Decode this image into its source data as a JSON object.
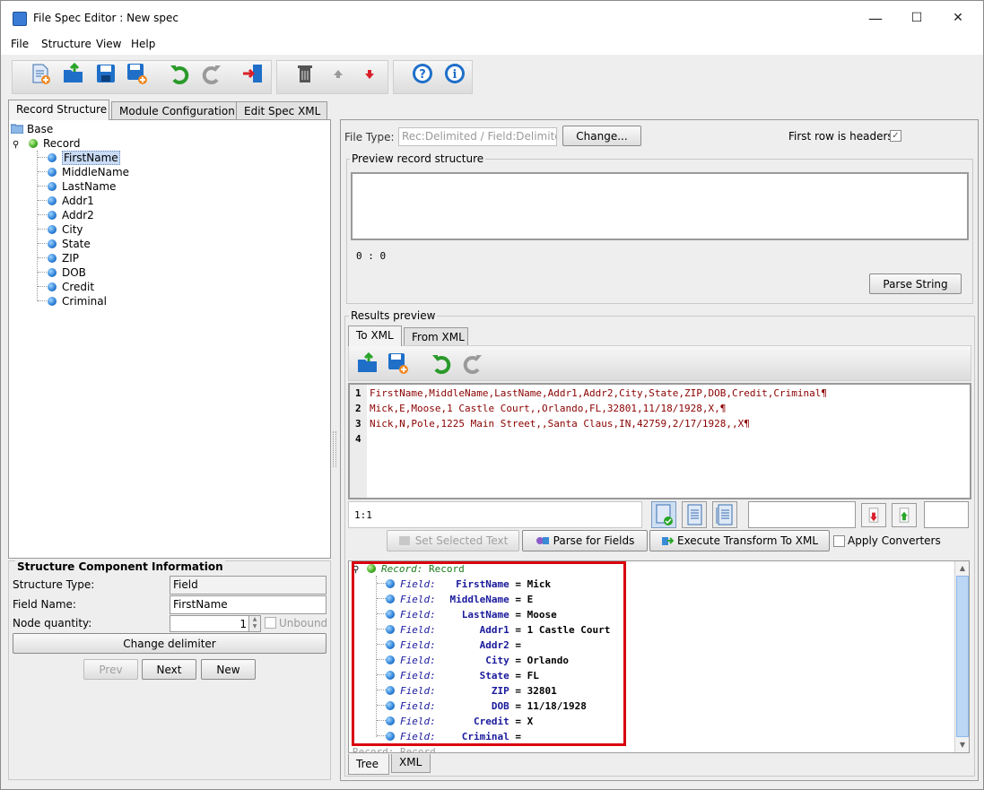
{
  "window": {
    "title": "File Spec Editor : New spec",
    "minimize": "—",
    "maximize": "☐",
    "close": "✕"
  },
  "menu": [
    "File",
    "Structure",
    "View",
    "Help"
  ],
  "left_tabs": [
    "Record Structure",
    "Module Configuration",
    "Edit Spec XML"
  ],
  "tree": {
    "root": "Base",
    "record": "Record",
    "fields": [
      "FirstName",
      "MiddleName",
      "LastName",
      "Addr1",
      "Addr2",
      "City",
      "State",
      "ZIP",
      "DOB",
      "Credit",
      "Criminal"
    ],
    "selected": "FirstName"
  },
  "sci": {
    "title": "Structure Component Information",
    "structure_type_label": "Structure Type:",
    "structure_type": "Field",
    "field_name_label": "Field Name:",
    "field_name": "FirstName",
    "node_quantity_label": "Node quantity:",
    "node_quantity": "1",
    "unbound_label": "Unbound",
    "change_delimiter": "Change delimiter",
    "prev": "Prev",
    "next": "Next",
    "new": "New"
  },
  "right": {
    "file_type_label": "File Type:",
    "file_type_value": "Rec:Delimited / Field:Delimited",
    "change_button": "Change...",
    "first_row_headers": "First row is headers",
    "first_row_checked": "✓",
    "preview_title": "Preview record structure",
    "preview_pos": "0 : 0",
    "parse_string": "Parse String",
    "results_title": "Results preview",
    "result_tabs": [
      "To XML",
      "From XML"
    ],
    "code_lines": [
      "FirstName,MiddleName,LastName,Addr1,Addr2,City,State,ZIP,DOB,Credit,Criminal¶",
      "Mick,E,Moose,1 Castle Court,,Orlando,FL,32801,11/18/1928,X,¶",
      "Nick,N,Pole,1225 Main Street,,Santa Claus,IN,42759,2/17/1928,,X¶",
      ""
    ],
    "line_numbers": [
      "1",
      "2",
      "3",
      "4"
    ],
    "cursor_pos": "1:1",
    "set_selected_text": "Set Selected Text",
    "parse_for_fields": "Parse for Fields",
    "execute_transform": "Execute Transform To XML",
    "apply_converters": "Apply Converters",
    "xml_tree": {
      "record_key": "Record:",
      "record_name": "Record",
      "field_key": "Field:",
      "fields": [
        {
          "name": "FirstName",
          "value": "Mick"
        },
        {
          "name": "MiddleName",
          "value": "E"
        },
        {
          "name": "LastName",
          "value": "Moose"
        },
        {
          "name": "Addr1",
          "value": "1 Castle Court"
        },
        {
          "name": "Addr2",
          "value": ""
        },
        {
          "name": "City",
          "value": "Orlando"
        },
        {
          "name": "State",
          "value": "FL"
        },
        {
          "name": "ZIP",
          "value": "32801"
        },
        {
          "name": "DOB",
          "value": "11/18/1928"
        },
        {
          "name": "Credit",
          "value": "X"
        },
        {
          "name": "Criminal",
          "value": ""
        }
      ],
      "next_record_partial": "Record: Record"
    },
    "bottom_tabs": [
      "Tree",
      "XML"
    ]
  },
  "colors": {
    "highlight_box": "#d9000d",
    "code_text": "#8b0000",
    "field_blue": "#1a1a9c",
    "record_green": "#1c7a1c"
  }
}
